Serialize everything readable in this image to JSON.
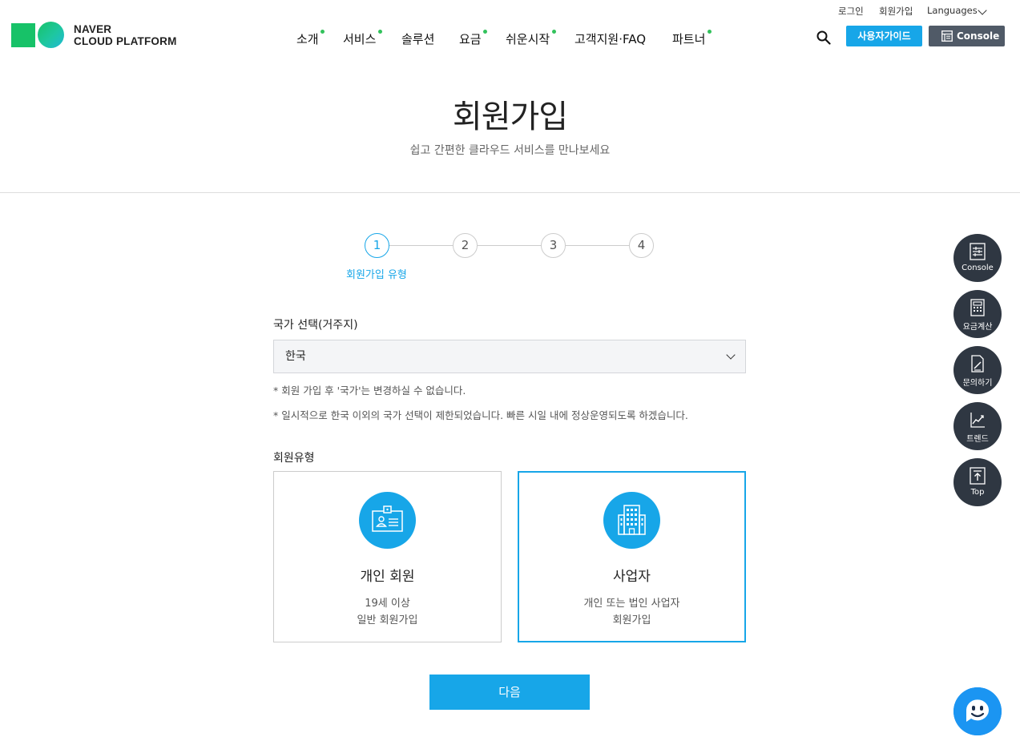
{
  "brand": {
    "line1": "NAVER",
    "line2": "CLOUD PLATFORM"
  },
  "util_links": {
    "login": "로그인",
    "signup": "회원가입",
    "languages": "Languages"
  },
  "nav": {
    "items": [
      {
        "label": "소개",
        "dot": true
      },
      {
        "label": "서비스",
        "dot": true
      },
      {
        "label": "솔루션",
        "dot": false
      },
      {
        "label": "요금",
        "dot": true
      },
      {
        "label": "쉬운시작",
        "dot": true
      },
      {
        "label": "고객지원·FAQ",
        "dot": false
      },
      {
        "label": "파트너",
        "dot": true
      }
    ]
  },
  "header_buttons": {
    "guide": "사용자가이드",
    "console": "Console"
  },
  "hero": {
    "title": "회원가입",
    "subtitle": "쉽고 간편한 클라우드 서비스를 만나보세요"
  },
  "stepper": {
    "steps": [
      "1",
      "2",
      "3",
      "4"
    ],
    "active_index": 0,
    "active_label": "회원가입 유형"
  },
  "form": {
    "country_label": "국가 선택(거주지)",
    "country_value": "한국",
    "notice1": "* 회원 가입 후 '국가'는 변경하실 수 없습니다.",
    "notice2": "* 일시적으로 한국 이외의 국가 선택이 제한되었습니다. 빠른 시일 내에 정상운영되도록 하겠습니다.",
    "member_type_label": "회원유형",
    "cards": [
      {
        "title": "개인 회원",
        "desc1": "19세 이상",
        "desc2": "일반 회원가입",
        "selected": false,
        "icon": "id-card-icon"
      },
      {
        "title": "사업자",
        "desc1": "개인 또는 법인 사업자",
        "desc2": "회원가입",
        "selected": true,
        "icon": "building-icon"
      }
    ],
    "next_button": "다음"
  },
  "side_menu": [
    {
      "label": "Console",
      "icon": "console-icon"
    },
    {
      "label": "요금계산",
      "icon": "calculator-icon"
    },
    {
      "label": "문의하기",
      "icon": "inquiry-icon"
    },
    {
      "label": "트렌드",
      "icon": "trend-chart-icon"
    },
    {
      "label": "Top",
      "icon": "arrow-up-icon"
    }
  ],
  "colors": {
    "accent": "#17a6e8",
    "brand_green": "#17c268",
    "dark": "#2f3742",
    "console_btn": "#505a67"
  }
}
